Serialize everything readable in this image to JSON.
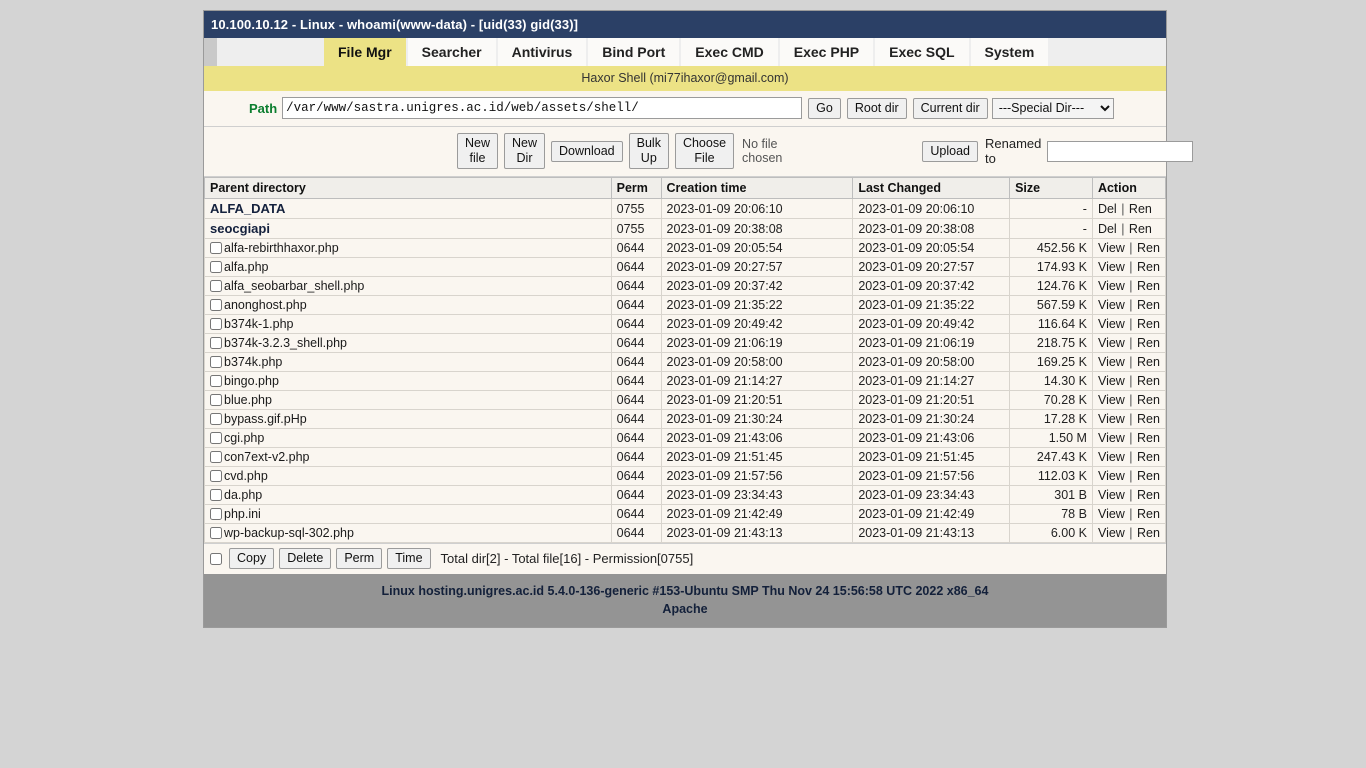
{
  "window": {
    "title": "10.100.10.12 - Linux - whoami(www-data) - [uid(33) gid(33)]"
  },
  "tabs": [
    {
      "label": "File Mgr",
      "active": true
    },
    {
      "label": "Searcher",
      "active": false
    },
    {
      "label": "Antivirus",
      "active": false
    },
    {
      "label": "Bind Port",
      "active": false
    },
    {
      "label": "Exec CMD",
      "active": false
    },
    {
      "label": "Exec PHP",
      "active": false
    },
    {
      "label": "Exec SQL",
      "active": false
    },
    {
      "label": "System",
      "active": false
    }
  ],
  "subtitle": "Haxor Shell (mi77ihaxor@gmail.com)",
  "path_row": {
    "label": "Path",
    "value": "/var/www/sastra.unigres.ac.id/web/assets/shell/",
    "go_label": "Go",
    "root_dir_label": "Root dir",
    "current_dir_label": "Current dir",
    "special_dir_selected": "---Special Dir---"
  },
  "action_row": {
    "new_file_label": "New file",
    "new_dir_label": "New Dir",
    "download_label": "Download",
    "bulk_up_label": "Bulk Up",
    "choose_file_label": "Choose File",
    "no_file_text": "No file chosen",
    "upload_label": "Upload",
    "renamed_to_label": "Renamed to",
    "renamed_to_value": ""
  },
  "table": {
    "headers": [
      "Parent directory",
      "Perm",
      "Creation time",
      "Last Changed",
      "Size",
      "Action"
    ],
    "rows": [
      {
        "name": "ALFA_DATA",
        "type": "dir",
        "perm": "0755",
        "ctime": "2023-01-09 20:06:10",
        "mtime": "2023-01-09 20:06:10",
        "size": "-",
        "a1": "Del",
        "a2": "Ren"
      },
      {
        "name": "seocgiapi",
        "type": "dir",
        "perm": "0755",
        "ctime": "2023-01-09 20:38:08",
        "mtime": "2023-01-09 20:38:08",
        "size": "-",
        "a1": "Del",
        "a2": "Ren"
      },
      {
        "name": "alfa-rebirthhaxor.php",
        "type": "file",
        "perm": "0644",
        "ctime": "2023-01-09 20:05:54",
        "mtime": "2023-01-09 20:05:54",
        "size": "452.56 K",
        "a1": "View",
        "a2": "Ren"
      },
      {
        "name": "alfa.php",
        "type": "file",
        "perm": "0644",
        "ctime": "2023-01-09 20:27:57",
        "mtime": "2023-01-09 20:27:57",
        "size": "174.93 K",
        "a1": "View",
        "a2": "Ren"
      },
      {
        "name": "alfa_seobarbar_shell.php",
        "type": "file",
        "perm": "0644",
        "ctime": "2023-01-09 20:37:42",
        "mtime": "2023-01-09 20:37:42",
        "size": "124.76 K",
        "a1": "View",
        "a2": "Ren"
      },
      {
        "name": "anonghost.php",
        "type": "file",
        "perm": "0644",
        "ctime": "2023-01-09 21:35:22",
        "mtime": "2023-01-09 21:35:22",
        "size": "567.59 K",
        "a1": "View",
        "a2": "Ren"
      },
      {
        "name": "b374k-1.php",
        "type": "file",
        "perm": "0644",
        "ctime": "2023-01-09 20:49:42",
        "mtime": "2023-01-09 20:49:42",
        "size": "116.64 K",
        "a1": "View",
        "a2": "Ren"
      },
      {
        "name": "b374k-3.2.3_shell.php",
        "type": "file",
        "perm": "0644",
        "ctime": "2023-01-09 21:06:19",
        "mtime": "2023-01-09 21:06:19",
        "size": "218.75 K",
        "a1": "View",
        "a2": "Ren"
      },
      {
        "name": "b374k.php",
        "type": "file",
        "perm": "0644",
        "ctime": "2023-01-09 20:58:00",
        "mtime": "2023-01-09 20:58:00",
        "size": "169.25 K",
        "a1": "View",
        "a2": "Ren"
      },
      {
        "name": "bingo.php",
        "type": "file",
        "perm": "0644",
        "ctime": "2023-01-09 21:14:27",
        "mtime": "2023-01-09 21:14:27",
        "size": "14.30 K",
        "a1": "View",
        "a2": "Ren"
      },
      {
        "name": "blue.php",
        "type": "file",
        "perm": "0644",
        "ctime": "2023-01-09 21:20:51",
        "mtime": "2023-01-09 21:20:51",
        "size": "70.28 K",
        "a1": "View",
        "a2": "Ren"
      },
      {
        "name": "bypass.gif.pHp",
        "type": "file",
        "perm": "0644",
        "ctime": "2023-01-09 21:30:24",
        "mtime": "2023-01-09 21:30:24",
        "size": "17.28 K",
        "a1": "View",
        "a2": "Ren"
      },
      {
        "name": "cgi.php",
        "type": "file",
        "perm": "0644",
        "ctime": "2023-01-09 21:43:06",
        "mtime": "2023-01-09 21:43:06",
        "size": "1.50 M",
        "a1": "View",
        "a2": "Ren"
      },
      {
        "name": "con7ext-v2.php",
        "type": "file",
        "perm": "0644",
        "ctime": "2023-01-09 21:51:45",
        "mtime": "2023-01-09 21:51:45",
        "size": "247.43 K",
        "a1": "View",
        "a2": "Ren"
      },
      {
        "name": "cvd.php",
        "type": "file",
        "perm": "0644",
        "ctime": "2023-01-09 21:57:56",
        "mtime": "2023-01-09 21:57:56",
        "size": "112.03 K",
        "a1": "View",
        "a2": "Ren"
      },
      {
        "name": "da.php",
        "type": "file",
        "perm": "0644",
        "ctime": "2023-01-09 23:34:43",
        "mtime": "2023-01-09 23:34:43",
        "size": "301 B",
        "a1": "View",
        "a2": "Ren"
      },
      {
        "name": "php.ini",
        "type": "file",
        "perm": "0644",
        "ctime": "2023-01-09 21:42:49",
        "mtime": "2023-01-09 21:42:49",
        "size": "78 B",
        "a1": "View",
        "a2": "Ren"
      },
      {
        "name": "wp-backup-sql-302.php",
        "type": "file",
        "perm": "0644",
        "ctime": "2023-01-09 21:43:13",
        "mtime": "2023-01-09 21:43:13",
        "size": "6.00 K",
        "a1": "View",
        "a2": "Ren"
      }
    ]
  },
  "bottom_bar": {
    "copy_label": "Copy",
    "delete_label": "Delete",
    "perm_label": "Perm",
    "time_label": "Time",
    "totals": "Total dir[2] - Total file[16] - Permission[0755]"
  },
  "footer": {
    "line1": "Linux hosting.unigres.ac.id 5.4.0-136-generic #153-Ubuntu SMP Thu Nov 24 15:56:58 UTC 2022 x86_64",
    "line2": "Apache"
  },
  "colors": {
    "titlebar": "#2b4066",
    "accent_yellow": "#ece285",
    "page_bg": "#d4d4d4",
    "panel_bg": "#faf6f0",
    "footer_bg": "#949494",
    "path_label": "#0a7d2e"
  }
}
